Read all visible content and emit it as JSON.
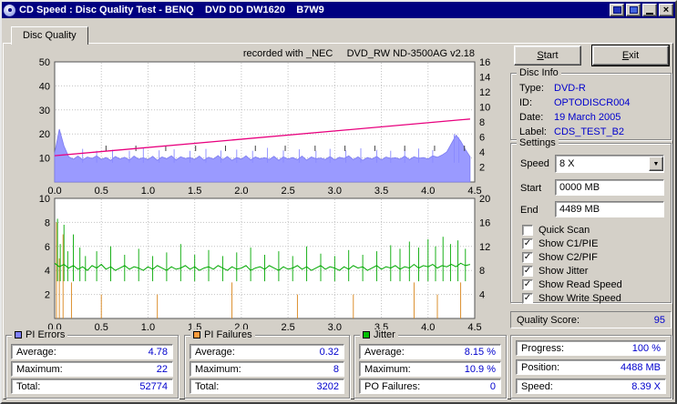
{
  "titlebar": {
    "title": "CD Speed : Disc Quality Test - BENQ    DVD DD DW1620    B7W9"
  },
  "tab": {
    "label": "Disc Quality"
  },
  "buttons": {
    "start_accel": "S",
    "start_rest": "tart",
    "exit_accel": "E",
    "exit_rest": "xit"
  },
  "disc_info": {
    "title": "Disc Info",
    "rows": [
      {
        "label": "Type:",
        "value": "DVD-R"
      },
      {
        "label": "ID:",
        "value": "OPTODISCR004"
      },
      {
        "label": "Date:",
        "value": "19 March 2005"
      },
      {
        "label": "Label:",
        "value": "CDS_TEST_B2"
      }
    ]
  },
  "settings": {
    "title": "Settings",
    "speed_label": "Speed",
    "speed_value": "8 X",
    "start_label": "Start",
    "start_value": "0000 MB",
    "end_label": "End",
    "end_value": "4489 MB",
    "checkboxes": [
      {
        "label": "Quick Scan",
        "checked": false
      },
      {
        "label": "Show C1/PIE",
        "checked": true
      },
      {
        "label": "Show C2/PIF",
        "checked": true
      },
      {
        "label": "Show Jitter",
        "checked": true
      },
      {
        "label": "Show Read Speed",
        "checked": true
      },
      {
        "label": "Show Write Speed",
        "checked": true
      }
    ]
  },
  "quality_score": {
    "label": "Quality Score:",
    "value": "95"
  },
  "status": {
    "rows": [
      {
        "label": "Progress:",
        "value": "100 %"
      },
      {
        "label": "Position:",
        "value": "4488 MB"
      },
      {
        "label": "Speed:",
        "value": "8.39 X"
      }
    ]
  },
  "legends": [
    {
      "title": "PI Errors",
      "color": "#8080ff",
      "rows": [
        {
          "label": "Average:",
          "value": "4.78"
        },
        {
          "label": "Maximum:",
          "value": "22"
        },
        {
          "label": "Total:",
          "value": "52774"
        }
      ]
    },
    {
      "title": "PI Failures",
      "color": "#ff9b3c",
      "rows": [
        {
          "label": "Average:",
          "value": "0.32"
        },
        {
          "label": "Maximum:",
          "value": "8"
        },
        {
          "label": "Total:",
          "value": "3202"
        }
      ]
    },
    {
      "title": "Jitter",
      "color": "#00c000",
      "rows": [
        {
          "label": "Average:",
          "value": "8.15 %"
        },
        {
          "label": "Maximum:",
          "value": "10.9 %"
        },
        {
          "label": "PO Failures:",
          "value": "0"
        }
      ]
    }
  ],
  "chart_data": [
    {
      "type": "area",
      "name": "pi-errors-speed-chart",
      "header": "recorded with _NEC     DVD_RW ND-3500AG v2.18",
      "x_range": [
        0,
        4.5
      ],
      "x_ticks": [
        0,
        0.5,
        1,
        1.5,
        2,
        2.5,
        3,
        3.5,
        4,
        4.5
      ],
      "left_axis": {
        "range": [
          0,
          50
        ],
        "ticks": [
          10,
          20,
          30,
          40,
          50
        ]
      },
      "right_axis": {
        "range": [
          0,
          16
        ],
        "ticks": [
          2,
          4,
          6,
          8,
          10,
          12,
          14,
          16
        ]
      },
      "grid": true,
      "series": [
        {
          "name": "pi-errors",
          "legend": "PI Errors",
          "type": "area",
          "axis": "left",
          "color": "#7b7bf0",
          "fill": "#9a9aff",
          "x_step": 0.05,
          "values": [
            12,
            22,
            15,
            10.5,
            9.5,
            10.8,
            9.2,
            10.4,
            9.8,
            10.9,
            9.4,
            10.2,
            9,
            10.6,
            9.6,
            10.3,
            9.1,
            10.8,
            9.5,
            10.1,
            9.3,
            10.7,
            9,
            10.4,
            9.7,
            10.9,
            9.2,
            10.5,
            9.8,
            10.2,
            9.4,
            10.8,
            9.1,
            10.3,
            9.6,
            11,
            9.3,
            10.6,
            9,
            10.2,
            9.5,
            10.9,
            9.2,
            10.4,
            9.7,
            10.1,
            9.4,
            10.7,
            9,
            10.5,
            9.6,
            10.2,
            9.3,
            10.8,
            9.1,
            10.4,
            9.7,
            10,
            9.4,
            10.6,
            9.2,
            10.3,
            9.8,
            10.9,
            9.3,
            10.5,
            9,
            10.2,
            9.6,
            10.7,
            9.2,
            10.4,
            9.8,
            10.1,
            9.5,
            10.8,
            9.3,
            10.5,
            9.9,
            10.2,
            9.6,
            10.9,
            10.3,
            11.2,
            12.5,
            16,
            19.5,
            17,
            13.5,
            10.5
          ]
        },
        {
          "name": "pi-error-peaks",
          "type": "spikes",
          "axis": "left",
          "color": "#8a8aff",
          "base": 8,
          "points": [
            [
              0.3,
              13.8
            ],
            [
              0.45,
              13
            ],
            [
              0.62,
              13.4
            ],
            [
              0.8,
              13
            ],
            [
              0.95,
              14
            ],
            [
              1.12,
              13.2
            ],
            [
              1.28,
              13.6
            ],
            [
              1.45,
              13
            ],
            [
              1.62,
              13.8
            ],
            [
              1.78,
              13.1
            ],
            [
              1.95,
              13.5
            ],
            [
              2.12,
              13
            ],
            [
              2.28,
              14.2
            ],
            [
              2.45,
              13.2
            ],
            [
              2.62,
              13.6
            ],
            [
              2.8,
              13
            ],
            [
              2.95,
              13.8
            ],
            [
              3.12,
              13.2
            ],
            [
              3.28,
              14
            ],
            [
              3.45,
              13.4
            ],
            [
              3.6,
              13
            ],
            [
              3.75,
              13.6
            ],
            [
              3.9,
              13.9
            ],
            [
              4.05,
              13.3
            ],
            [
              4.28,
              20
            ],
            [
              4.33,
              18.5
            ]
          ]
        },
        {
          "name": "speed-markers",
          "type": "ticks",
          "axis": "left",
          "color": "#404040",
          "y": 14,
          "x": [
            0.55,
            0.87,
            1.19,
            1.51,
            1.83,
            2.15,
            2.47,
            2.79,
            3.11,
            3.43,
            3.75,
            4.07,
            4.39
          ]
        },
        {
          "name": "write-speed",
          "legend": "Write Speed",
          "type": "line",
          "axis": "right",
          "color": "#e8007e",
          "width": 1.3,
          "points": [
            [
              0,
              3.5
            ],
            [
              4.45,
              8.39
            ]
          ]
        }
      ]
    },
    {
      "type": "line",
      "name": "jitter-pif-chart",
      "x_range": [
        0,
        4.5
      ],
      "x_ticks": [
        0,
        0.5,
        1,
        1.5,
        2,
        2.5,
        3,
        3.5,
        4,
        4.5
      ],
      "left_axis": {
        "range": [
          0,
          10
        ],
        "ticks": [
          2,
          4,
          6,
          8,
          10
        ]
      },
      "right_axis": {
        "range": [
          0,
          20
        ],
        "ticks": [
          4,
          8,
          12,
          16,
          20
        ]
      },
      "grid": true,
      "series": [
        {
          "name": "pi-failures",
          "legend": "PI Failures",
          "type": "spikes",
          "axis": "left",
          "color": "#d88418",
          "base": 0,
          "points": [
            [
              0.02,
              8
            ],
            [
              0.05,
              5
            ],
            [
              0.09,
              7
            ],
            [
              0.18,
              3
            ],
            [
              0.5,
              2
            ],
            [
              1.1,
              2
            ],
            [
              1.9,
              3
            ],
            [
              2.6,
              2
            ],
            [
              3.2,
              2
            ],
            [
              3.85,
              3
            ],
            [
              4.1,
              2
            ],
            [
              4.35,
              3
            ]
          ]
        },
        {
          "name": "jitter-spikes",
          "type": "spikes",
          "axis": "left",
          "color": "#00a800",
          "base": 3.1,
          "points": [
            [
              0.03,
              8.3
            ],
            [
              0.06,
              6.2
            ],
            [
              0.1,
              7.8
            ],
            [
              0.14,
              5.6
            ],
            [
              0.2,
              7
            ],
            [
              0.27,
              5.9
            ],
            [
              0.33,
              5.2
            ],
            [
              0.45,
              5.6
            ],
            [
              0.6,
              6
            ],
            [
              0.75,
              5.3
            ],
            [
              0.9,
              5.8
            ],
            [
              1.05,
              5.2
            ],
            [
              1.2,
              5.5
            ],
            [
              1.35,
              6.2
            ],
            [
              1.5,
              5.3
            ],
            [
              1.65,
              5.7
            ],
            [
              1.8,
              5.2
            ],
            [
              1.95,
              5.5
            ],
            [
              2.1,
              5.9
            ],
            [
              2.25,
              5.3
            ],
            [
              2.4,
              5.6
            ],
            [
              2.55,
              5.2
            ],
            [
              2.7,
              6
            ],
            [
              2.85,
              5.4
            ],
            [
              3,
              5.2
            ],
            [
              3.15,
              5.7
            ],
            [
              3.3,
              5.3
            ],
            [
              3.45,
              5.6
            ],
            [
              3.6,
              6.1
            ],
            [
              3.7,
              5.8
            ],
            [
              3.8,
              6.4
            ],
            [
              3.9,
              5.9
            ],
            [
              4,
              6.6
            ],
            [
              4.08,
              6
            ],
            [
              4.16,
              6.8
            ],
            [
              4.24,
              6.2
            ],
            [
              4.32,
              6.5
            ],
            [
              4.4,
              5.8
            ]
          ]
        },
        {
          "name": "jitter",
          "legend": "Jitter",
          "type": "noisyline",
          "axis": "left",
          "color": "#00a800",
          "x_step": 0.05,
          "values": [
            4.6,
            4.3,
            4.5,
            4.2,
            4.4,
            4.1,
            4.3,
            4,
            4.4,
            4.2,
            4.5,
            4.1,
            4.3,
            4,
            4.2,
            4.4,
            4.1,
            4.3,
            4.2,
            4,
            4.3,
            4.1,
            4.4,
            4.2,
            4,
            4.3,
            4.1,
            4.2,
            4.4,
            4.1,
            4.3,
            4,
            4.2,
            4.3,
            4.1,
            4.4,
            4.2,
            4,
            4.3,
            4.1,
            4.2,
            4.4,
            4,
            4.2,
            4.3,
            4.1,
            4.4,
            4.2,
            4,
            4.3,
            4.1,
            4.2,
            4.4,
            4.1,
            4.3,
            4,
            4.2,
            4.4,
            4.1,
            4.3,
            4.2,
            4,
            4.3,
            4.1,
            4.4,
            4.2,
            4.3,
            4,
            4.2,
            4.4,
            4.1,
            4.3,
            4.2,
            4.4,
            4.1,
            4.3,
            4.2,
            4.5,
            4.2,
            4.4,
            4.3,
            4.5,
            4.2,
            4.4,
            4.3,
            4.5,
            4.3,
            4.6,
            4.4,
            4.5
          ]
        }
      ]
    }
  ]
}
